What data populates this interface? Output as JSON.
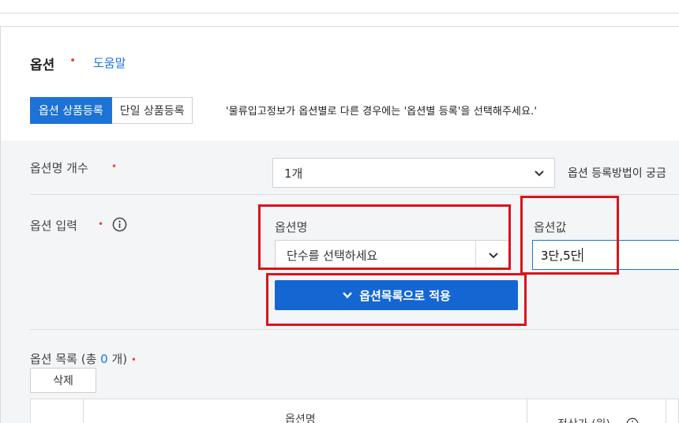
{
  "option_section": {
    "title": "옵션",
    "required_mark": "•",
    "help_link": "도움말",
    "tabs": [
      {
        "label": "옵션 상품등록",
        "active": true
      },
      {
        "label": "단일 상품등록",
        "active": false
      }
    ],
    "notice": "'물류입고정보가 옵션별로 다른 경우에는 '옵션별 등록'을 선택해주세요.'"
  },
  "option_count_row": {
    "label": "옵션명 개수",
    "required_mark": "•",
    "selected_value": "1개",
    "info_text": "옵션 등록방법이 궁금"
  },
  "option_input_row": {
    "label": "옵션 입력",
    "required_mark": "•",
    "info_icon": "info-circle-icon",
    "option_name_label": "옵션명",
    "option_name_value": "단수를 선택하세요",
    "option_value_label": "옵션값",
    "option_value_input": "3단,5단",
    "apply_button": "옵션목록으로 적용"
  },
  "option_list": {
    "label_prefix": "옵션 목록 (총 ",
    "count": "0",
    "label_suffix": " 개)",
    "required_mark": "•",
    "delete_button": "삭제",
    "columns": [
      "옵션명",
      "정상가 (원)"
    ]
  },
  "colors": {
    "accent": "#1d72d6",
    "required": "#e64a3b",
    "highlight_box": "#d9141b"
  }
}
